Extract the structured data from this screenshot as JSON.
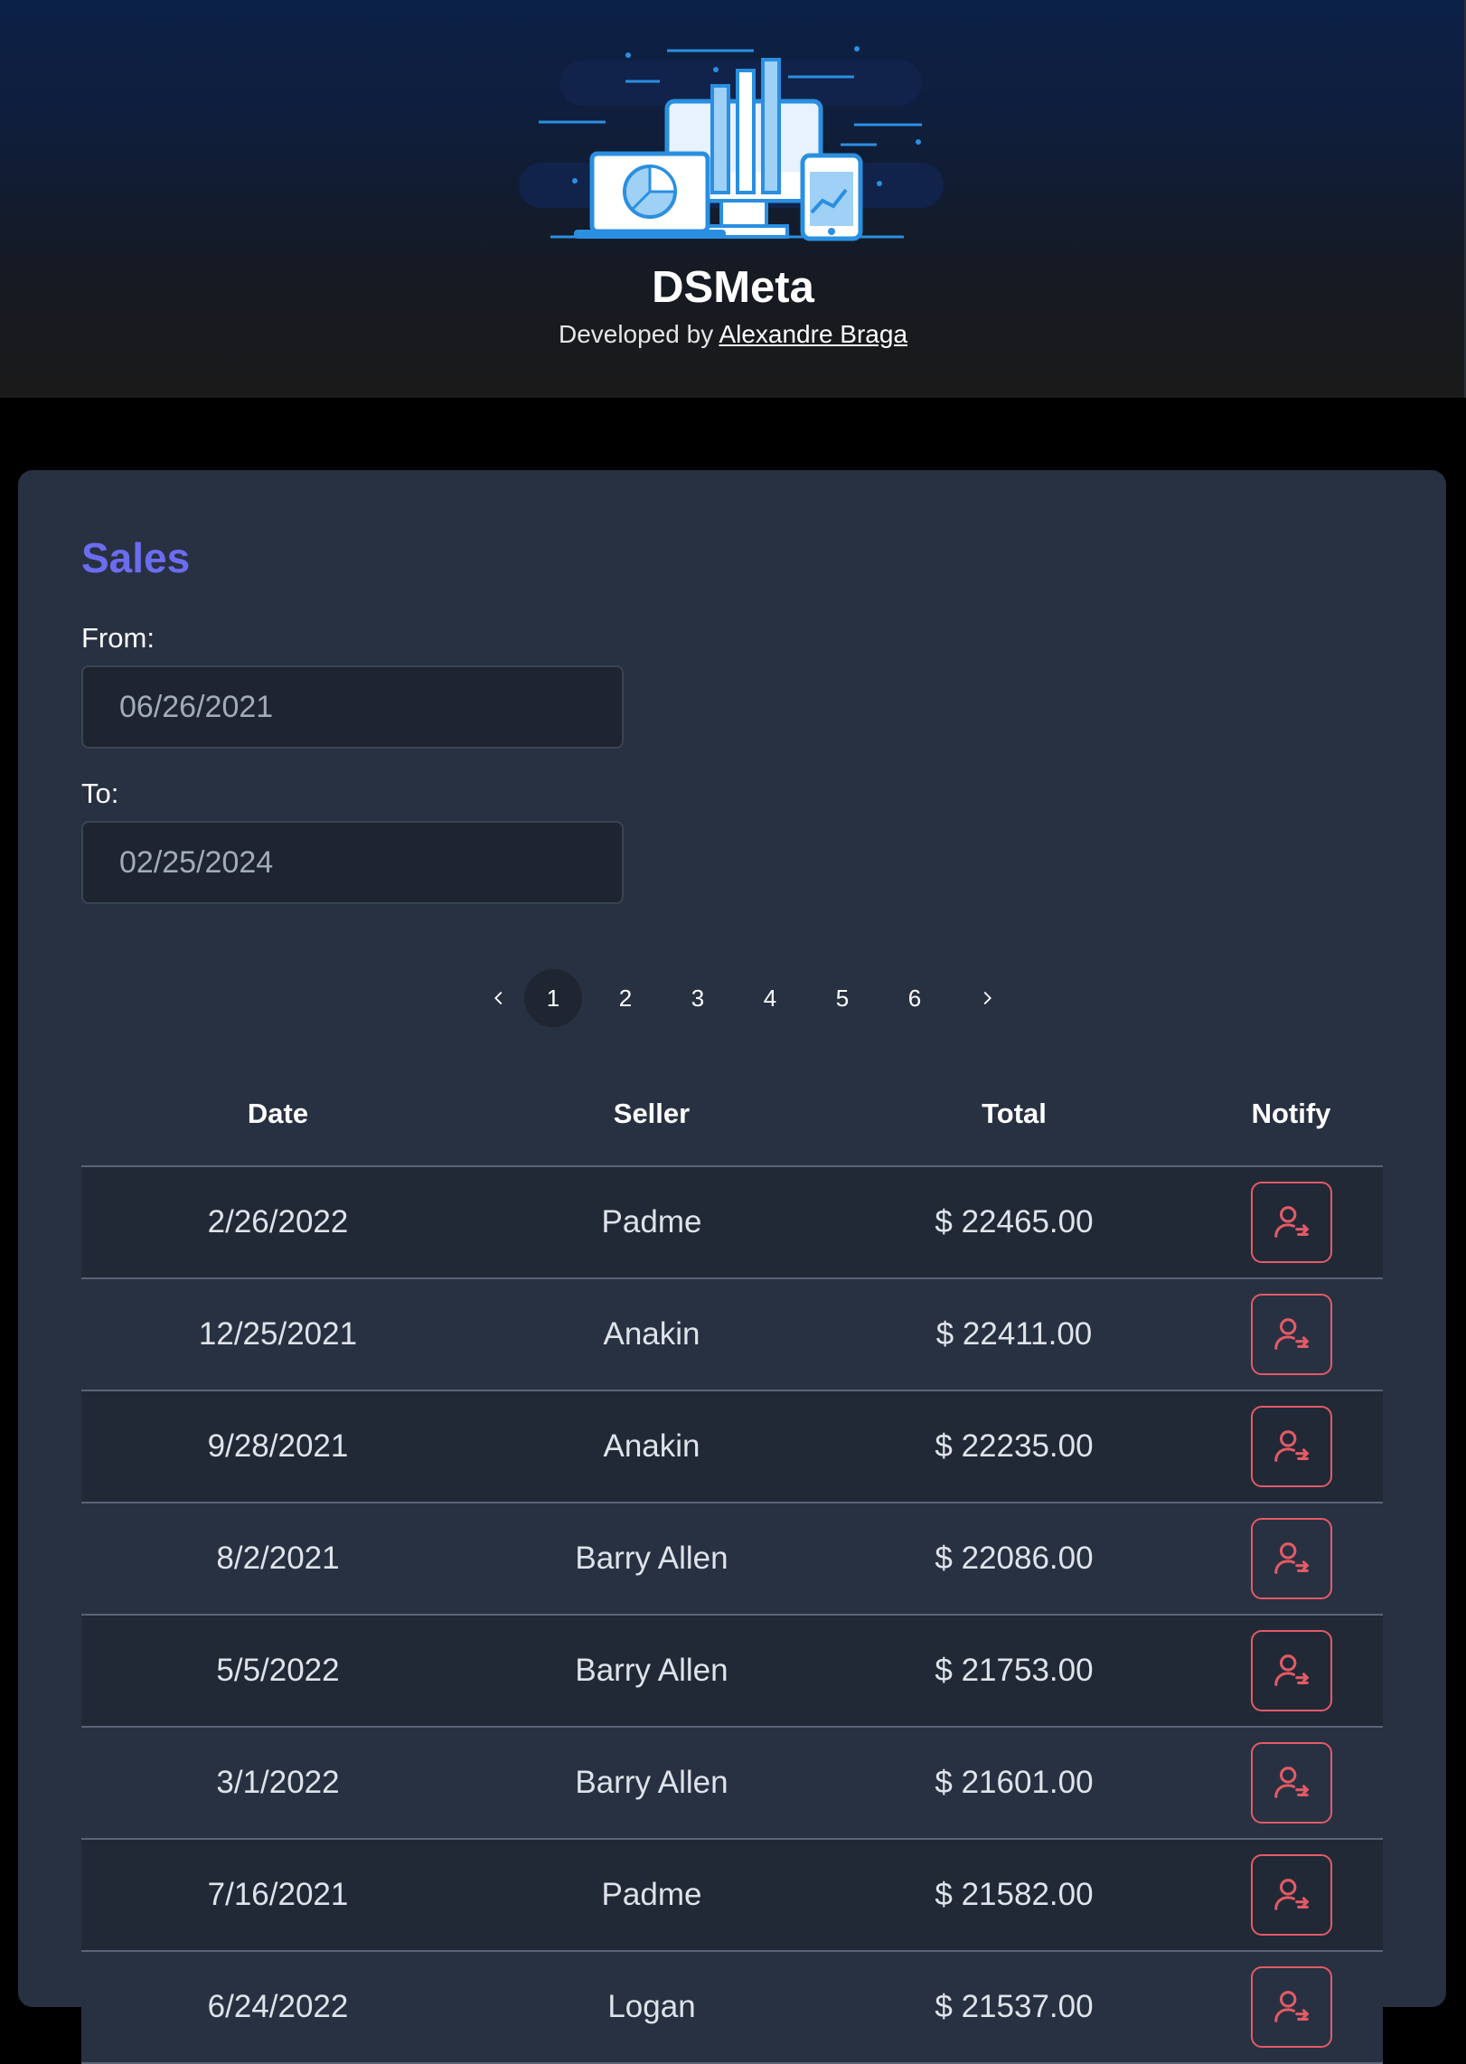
{
  "header": {
    "app_title": "DSMeta",
    "credit_prefix": "Developed by",
    "author_name": "Alexandre Braga",
    "logo_icon": "dashboard-devices-illustration"
  },
  "sales": {
    "title": "Sales",
    "from_label": "From:",
    "from_value": "06/26/2021",
    "to_label": "To:",
    "to_value": "02/25/2024"
  },
  "pagination": {
    "prev_icon": "chevron-left-icon",
    "next_icon": "chevron-right-icon",
    "pages": [
      "1",
      "2",
      "3",
      "4",
      "5",
      "6"
    ],
    "active_page": "1"
  },
  "table": {
    "columns": [
      "Date",
      "Seller",
      "Total",
      "Notify"
    ],
    "notify_icon": "user-notify-icon",
    "rows": [
      {
        "date": "2/26/2022",
        "seller": "Padme",
        "total": "$ 22465.00"
      },
      {
        "date": "12/25/2021",
        "seller": "Anakin",
        "total": "$ 22411.00"
      },
      {
        "date": "9/28/2021",
        "seller": "Anakin",
        "total": "$ 22235.00"
      },
      {
        "date": "8/2/2021",
        "seller": "Barry Allen",
        "total": "$ 22086.00"
      },
      {
        "date": "5/5/2022",
        "seller": "Barry Allen",
        "total": "$ 21753.00"
      },
      {
        "date": "3/1/2022",
        "seller": "Barry Allen",
        "total": "$ 21601.00"
      },
      {
        "date": "7/16/2021",
        "seller": "Padme",
        "total": "$ 21582.00"
      },
      {
        "date": "6/24/2022",
        "seller": "Logan",
        "total": "$ 21537.00"
      }
    ]
  },
  "colors": {
    "accent": "#6c6cf0",
    "card_bg": "#283142",
    "notify": "#e35b66"
  }
}
